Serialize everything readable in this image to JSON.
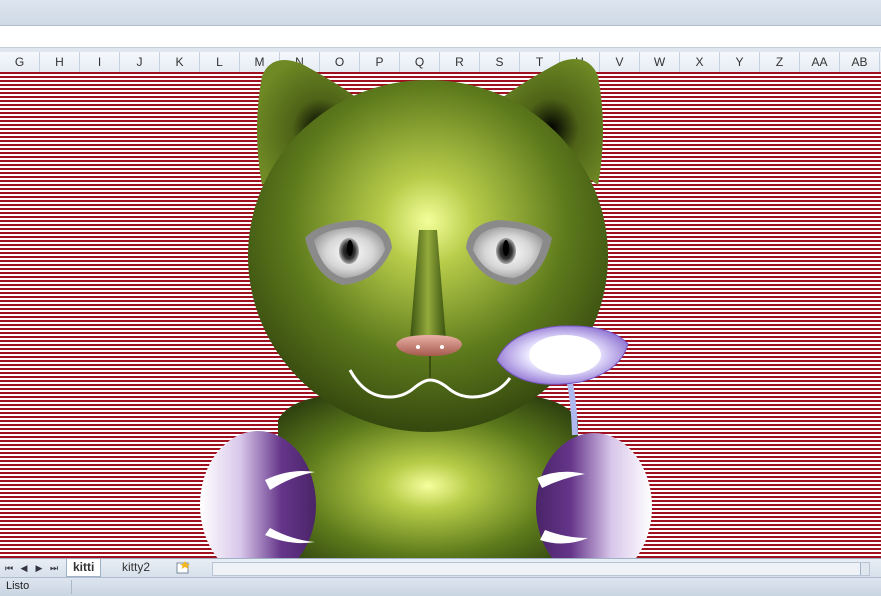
{
  "columns": [
    "G",
    "H",
    "I",
    "J",
    "K",
    "L",
    "M",
    "N",
    "O",
    "P",
    "Q",
    "R",
    "S",
    "T",
    "U",
    "V",
    "W",
    "X",
    "Y",
    "Z",
    "AA",
    "AB"
  ],
  "sheet_tabs": [
    "kitti",
    "kitty2"
  ],
  "active_tab": "kitti",
  "status": "Listo",
  "nav_buttons": [
    "first-sheet",
    "prev-sheet",
    "next-sheet",
    "last-sheet"
  ],
  "colors": {
    "stripe_red": "#a01020",
    "cat_green": "#5f7a1e",
    "paw_purple": "#5a2f7a",
    "flower_violet": "#8f72d4"
  }
}
